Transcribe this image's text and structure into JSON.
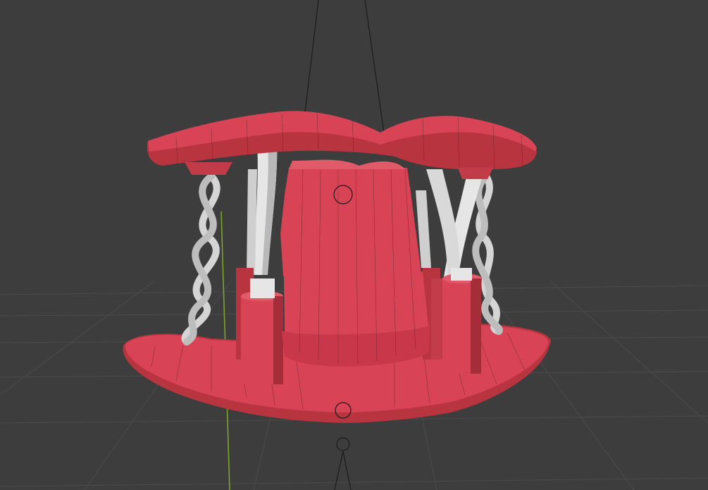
{
  "viewport": {
    "background": "#3d3d3d",
    "grid_color": "#4d4d4d",
    "y_axis_color": "#7da52a",
    "wire_color": "#1b1b1b"
  },
  "model": {
    "body_color": "#d84355",
    "body_shade_color": "#b8343f",
    "body_dark_color": "#8f2530",
    "support_color": "#e6e6e6",
    "support_shade_color": "#9a9a9a",
    "rope_color": "#d5d5d5"
  },
  "icons": {
    "origin": "object-origin-icon",
    "pivot": "pivot-point-icon",
    "empty": "empty-object-icon"
  }
}
